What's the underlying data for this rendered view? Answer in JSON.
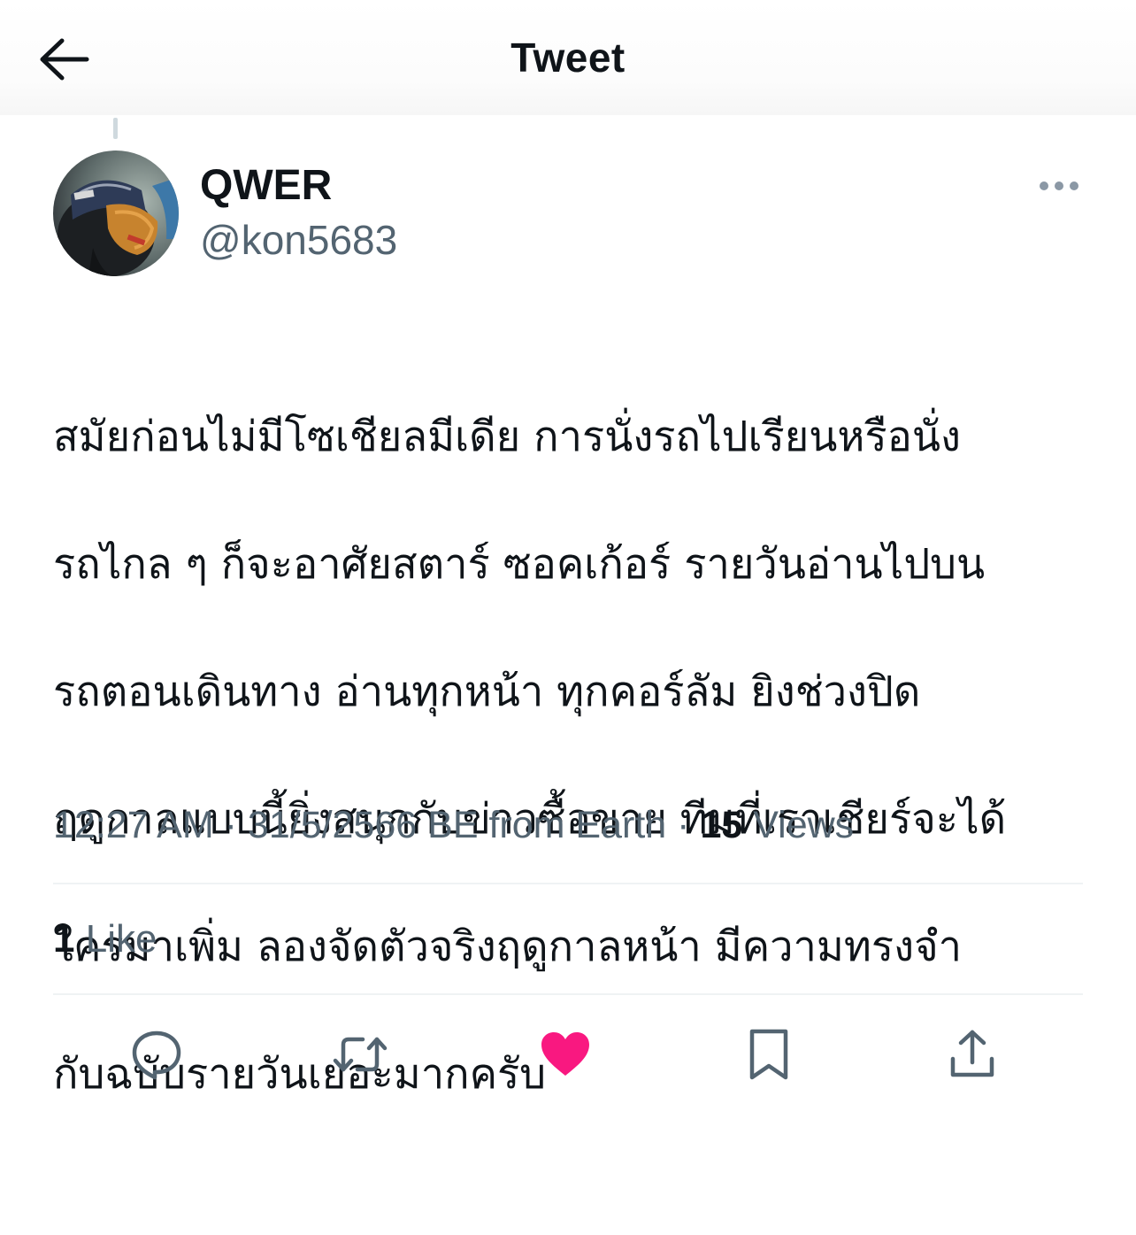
{
  "header": {
    "title": "Tweet",
    "back_icon": "arrow-left-icon"
  },
  "author": {
    "display_name": "QWER",
    "handle": "@kon5683"
  },
  "tweet": {
    "text_lines": [
      "สมัยก่อนไม่มีโซเชียลมีเดีย การนั่งรถไปเรียนหรือนั่ง",
      "รถไกล ๆ ก็จะอาศัยสตาร์ ซอคเก้อร์ รายวันอ่านไปบน",
      "รถตอนเดินทาง อ่านทุกหน้า ทุกคอร์ลัม ยิงช่วงปิด",
      "ฤดูกาลแบบนี้ยิ่งสนุกกับข่าวซื้อขาย ทีมที่เราเชียร์จะได้",
      "ใครมาเพิ่ม ลองจัดตัวจริงฤดูกาลหน้า มีความทรงจำ",
      "กับฉบับรายวันเยอะมากครับ"
    ]
  },
  "meta": {
    "time": "12:27 AM",
    "separator": "·",
    "date": "31/5/2566 BE",
    "source": "from Earth",
    "views_count": "15",
    "views_label": "Views"
  },
  "engagement": {
    "likes_count": "1",
    "likes_label": "Like"
  },
  "actions": [
    {
      "name": "reply",
      "icon": "speech-bubble-icon"
    },
    {
      "name": "retweet",
      "icon": "retweet-arrows-icon"
    },
    {
      "name": "like",
      "icon": "heart-icon",
      "active": true
    },
    {
      "name": "bookmark",
      "icon": "bookmark-icon"
    },
    {
      "name": "share",
      "icon": "share-upload-icon"
    }
  ],
  "colors": {
    "text_primary": "#0f1419",
    "text_secondary": "#536471",
    "like_active": "#f91880",
    "divider": "#eff3f4"
  }
}
